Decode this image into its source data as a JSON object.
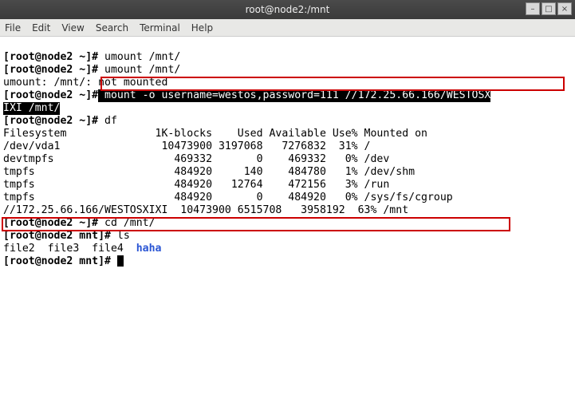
{
  "window": {
    "title": "root@node2:/mnt",
    "controls": {
      "min": "–",
      "max": "□",
      "close": "×"
    }
  },
  "menu": {
    "file": "File",
    "edit": "Edit",
    "view": "View",
    "search": "Search",
    "terminal": "Terminal",
    "help": "Help"
  },
  "term": {
    "p1": "[root@node2 ~]# ",
    "cmd1": "umount /mnt/",
    "p2": "[root@node2 ~]# ",
    "cmd2": "umount /mnt/",
    "err1": "umount: /mnt/: not mounted",
    "p3a": "[root@node2 ~]#",
    "inv1": " mount -o username=westos,password=111 //172.25.66.166/WESTOSX",
    "inv2": "IXI /mnt/",
    "p4": "[root@node2 ~]# ",
    "cmd4": "df",
    "dfhead": "Filesystem              1K-blocks    Used Available Use% Mounted on",
    "df1": "/dev/vda1                10473900 3197068   7276832  31% /",
    "df2": "devtmpfs                   469332       0    469332   0% /dev",
    "df3": "tmpfs                      484920     140    484780   1% /dev/shm",
    "df4": "tmpfs                      484920   12764    472156   3% /run",
    "df5": "tmpfs                      484920       0    484920   0% /sys/fs/cgroup",
    "df6": "//172.25.66.166/WESTOSXIXI  10473900 6515708   3958192  63% /mnt",
    "p5": "[root@node2 ~]# ",
    "cmd5": "cd /mnt/",
    "p6": "[root@node2 mnt]# ",
    "cmd6": "ls",
    "ls_files": "file2  file3  file4  ",
    "ls_dir": "haha",
    "p7": "[root@node2 mnt]# "
  },
  "watermark": ""
}
